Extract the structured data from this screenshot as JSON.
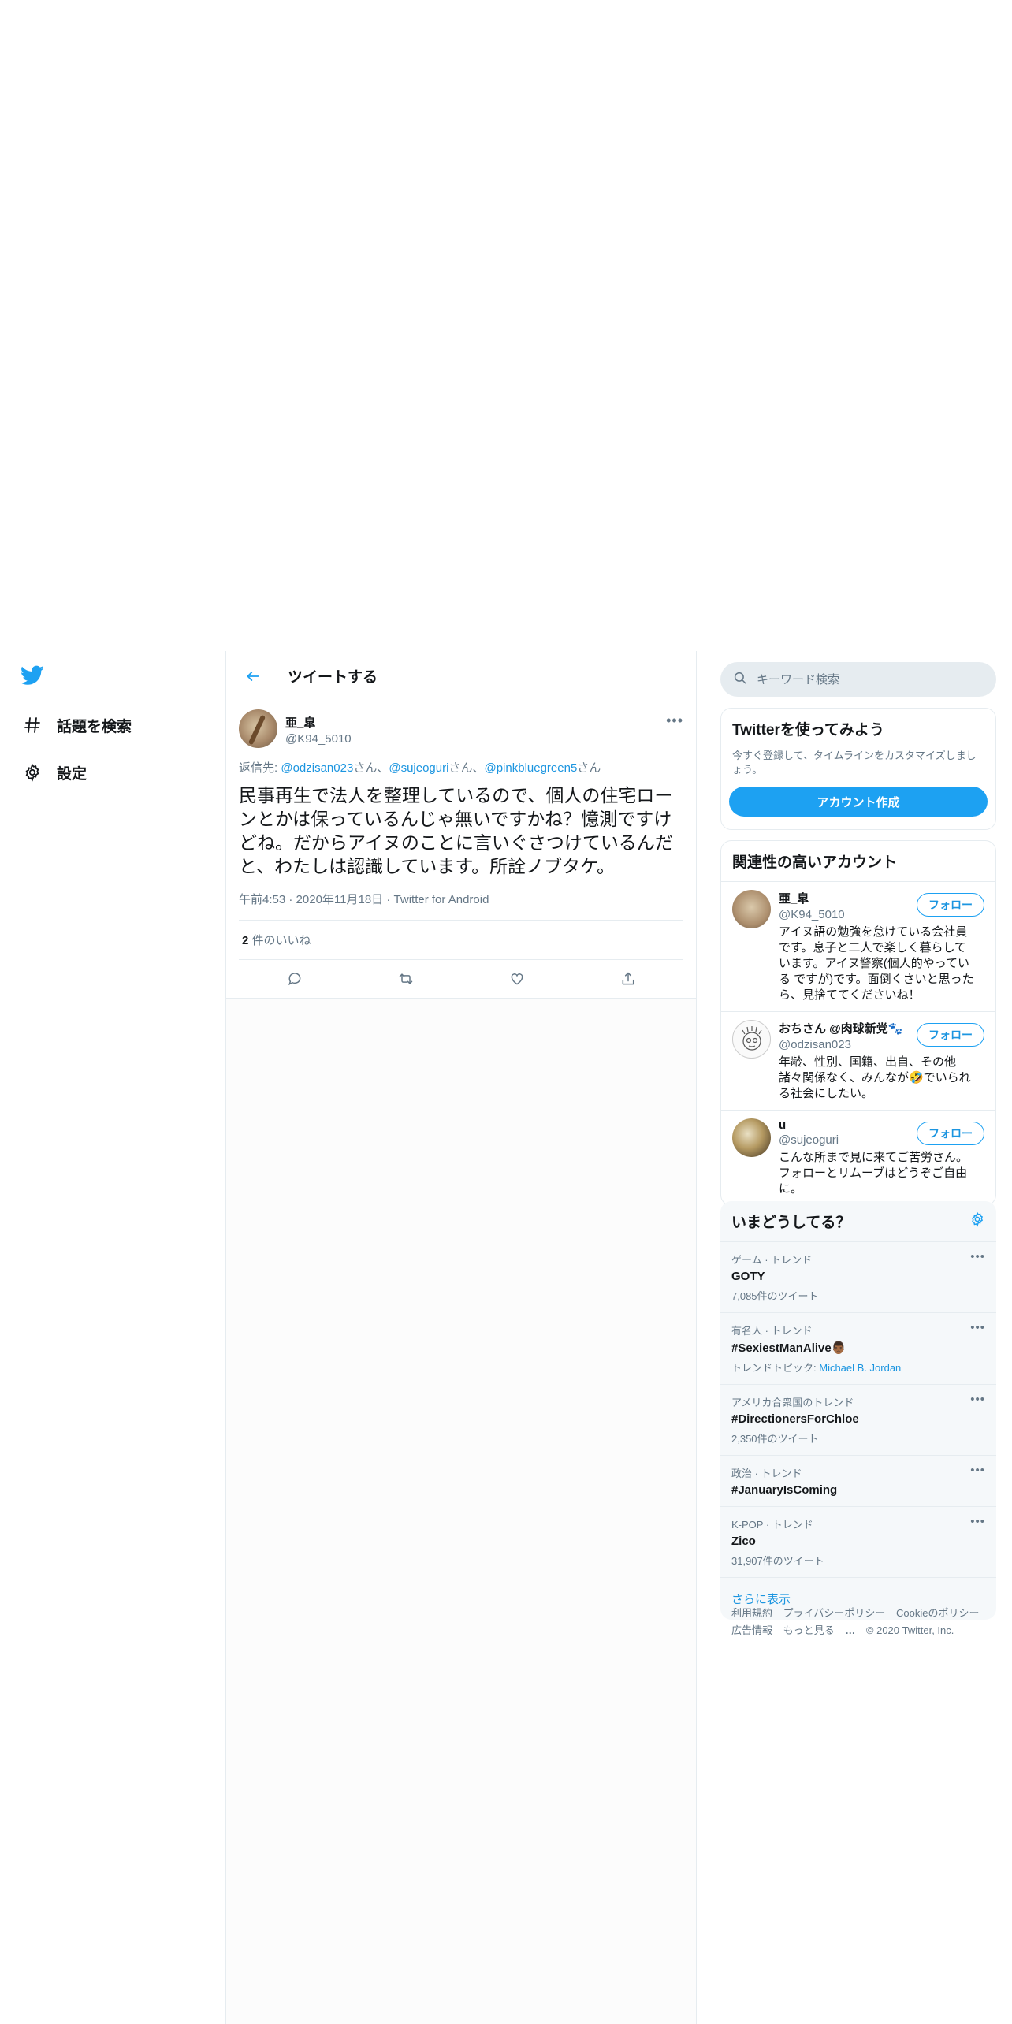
{
  "nav": {
    "items": [
      {
        "label": "話題を検索",
        "icon": "hashtag-icon"
      },
      {
        "label": "設定",
        "icon": "gear-icon"
      }
    ]
  },
  "header": {
    "title": "ツイートする"
  },
  "tweet": {
    "author_name": "亜_皐",
    "author_handle": "@K94_5010",
    "reply_prefix": "返信先: ",
    "mentions": [
      "@odzisan023",
      "@sujeoguri",
      "@pinkbluegreen5"
    ],
    "mention_suffix": "さん",
    "mention_sep": "、",
    "text": "民事再生で法人を整理しているので、個人の住宅ローンとかは保っているんじゃ無いですかね？憶測ですけどね。だからアイヌのことに言いぐさつけているんだと、わたしは認識しています。所詮ノブタケ。",
    "time": "午前4:53",
    "date": "2020年11月18日",
    "source": "Twitter for Android",
    "sep": " · ",
    "likes_count": "2",
    "likes_label": " 件のいいね"
  },
  "search": {
    "placeholder": "キーワード検索"
  },
  "signup": {
    "title": "Twitterを使ってみよう",
    "desc": "今すぐ登録して、タイムラインをカスタマイズしましょう。",
    "button": "アカウント作成"
  },
  "related": {
    "title": "関連性の高いアカウント",
    "follow_label": "フォロー",
    "accounts": [
      {
        "name": "亜_皐",
        "handle": "@K94_5010",
        "bio": "アイヌ語の勉強を怠けている会社員です。息子と二人で楽しく暮らしています。アイヌ警察(個人的やっている ですが)です。面倒くさいと思ったら、見捨ててくださいね！"
      },
      {
        "name": "おちさん @肉球新党🐾",
        "handle": "@odzisan023",
        "bio": "年齢、性別、国籍、出自、その他諸々関係なく、みんなが🤣でいられる社会にしたい。"
      },
      {
        "name": "u",
        "handle": "@sujeoguri",
        "bio": "こんな所まで見に来てご苦労さん。フォローとリムーブはどうぞご自由に。"
      }
    ]
  },
  "trends": {
    "title": "いまどうしてる？",
    "items": [
      {
        "context": "ゲーム · トレンド",
        "name": "GOTY",
        "count": "7,085件のツイート",
        "topic_prefix": "",
        "topic_link": ""
      },
      {
        "context": "有名人 · トレンド",
        "name": "#SexiestManAlive👨🏾",
        "count": "",
        "topic_prefix": "トレンドトピック: ",
        "topic_link": "Michael B. Jordan"
      },
      {
        "context": "アメリカ合衆国のトレンド",
        "name": "#DirectionersForChloe",
        "count": "2,350件のツイート",
        "topic_prefix": "",
        "topic_link": ""
      },
      {
        "context": "政治 · トレンド",
        "name": "#JanuaryIsComing",
        "count": "",
        "topic_prefix": "",
        "topic_link": ""
      },
      {
        "context": "K-POP · トレンド",
        "name": "Zico",
        "count": "31,907件のツイート",
        "topic_prefix": "",
        "topic_link": ""
      }
    ],
    "show_more": "さらに表示"
  },
  "footer": {
    "links": [
      "利用規約",
      "プライバシーポリシー",
      "Cookieのポリシー",
      "広告情報",
      "もっと見る"
    ],
    "copyright": "© 2020 Twitter, Inc."
  },
  "colors": {
    "accent": "#1da1f2",
    "link": "#1b95e0",
    "muted": "#657786"
  }
}
